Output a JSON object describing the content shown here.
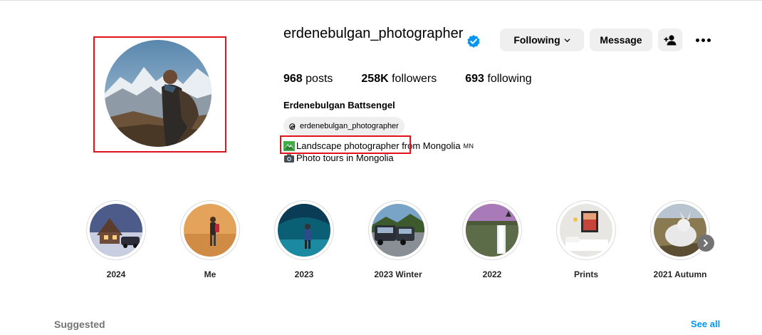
{
  "profile": {
    "username": "erdenebulgan_photographer",
    "full_name": "Erdenebulgan Battsengel",
    "threads_handle": "erdenebulgan_photographer",
    "bio_line1_highlight": "Landscape photographer",
    "bio_line1_rest": "from Mongolia",
    "bio_flag": "MN",
    "bio_line2": "Photo tours in Mongolia",
    "verified_color": "#0095f6"
  },
  "buttons": {
    "following": "Following",
    "message": "Message"
  },
  "stats": {
    "posts_count": "968",
    "posts_label": "posts",
    "followers_count": "258K",
    "followers_label": "followers",
    "following_count": "693",
    "following_label": "following"
  },
  "highlights": [
    {
      "label": "2024"
    },
    {
      "label": "Me"
    },
    {
      "label": "2023"
    },
    {
      "label": "2023 Winter"
    },
    {
      "label": "2022"
    },
    {
      "label": "Prints"
    },
    {
      "label": "2021 Autumn"
    }
  ],
  "suggested": {
    "title": "Suggested",
    "see_all": "See all"
  },
  "colors": {
    "link": "#0095f6",
    "annotation": "#e0131b",
    "button_bg": "#efefef"
  }
}
